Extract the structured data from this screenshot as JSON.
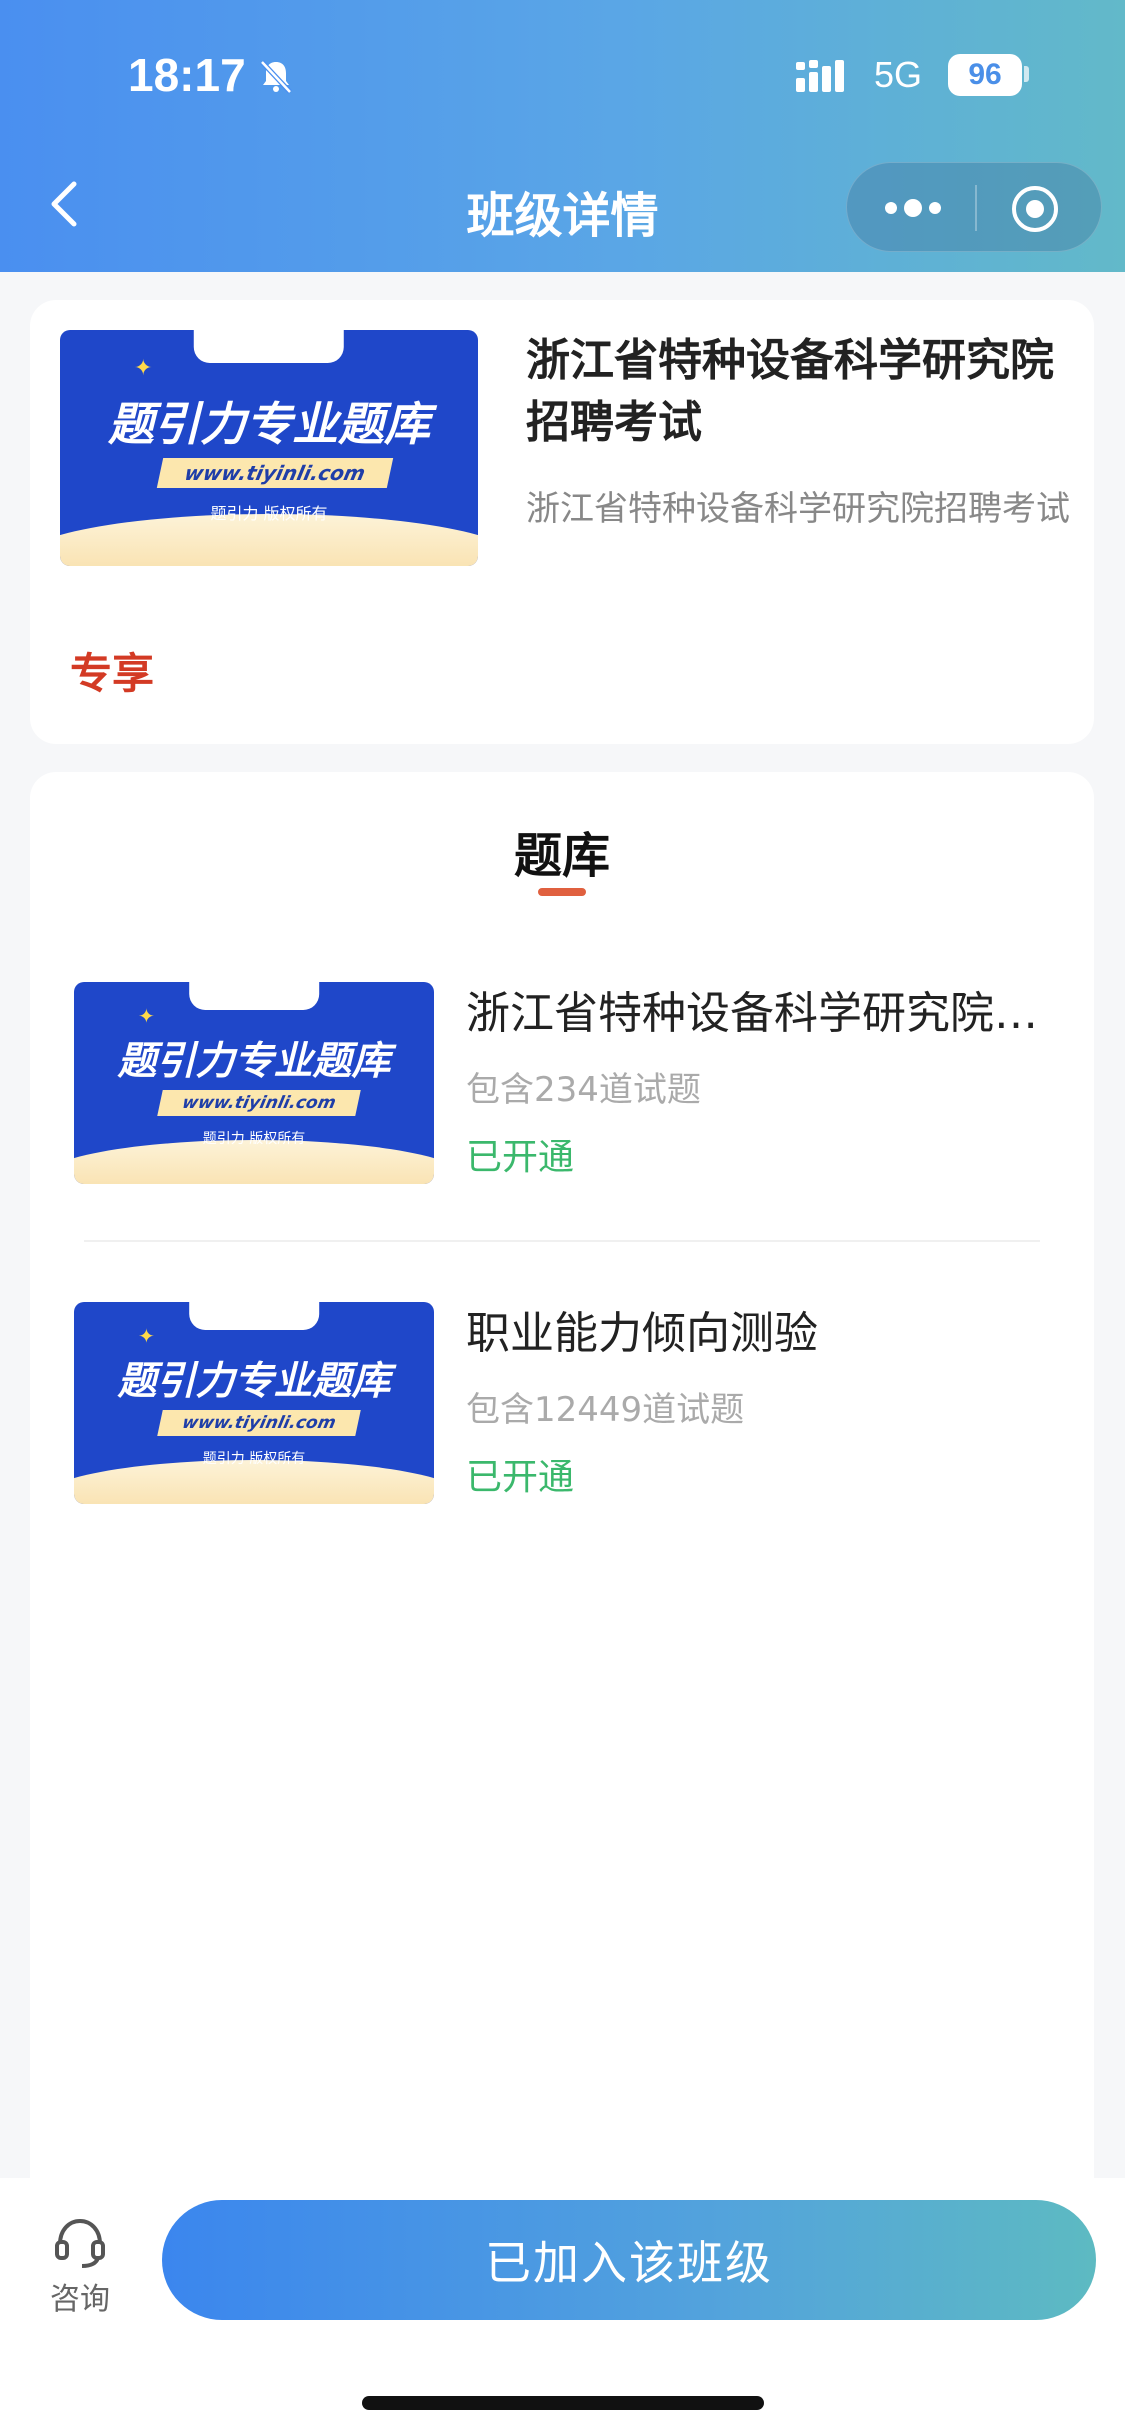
{
  "status_bar": {
    "time": "18:17",
    "network": "5G",
    "battery": "96"
  },
  "nav": {
    "title": "班级详情"
  },
  "class_card": {
    "banner": {
      "headline": "题引力专业题库",
      "url": "www.tiyinli.com",
      "copyright": "题引力 版权所有"
    },
    "title": "浙江省特种设备科学研究院招聘考试",
    "description": "浙江省特种设备科学研究院招聘考试",
    "tag": "专享"
  },
  "question_bank": {
    "section_title": "题库",
    "items": [
      {
        "name": "浙江省特种设备科学研究院招聘考试",
        "count": "包含234道试题",
        "status": "已开通",
        "banner": {
          "headline": "题引力专业题库",
          "url": "www.tiyinli.com",
          "copyright": "题引力 版权所有"
        }
      },
      {
        "name": "职业能力倾向测验",
        "count": "包含12449道试题",
        "status": "已开通",
        "banner": {
          "headline": "题引力专业题库",
          "url": "www.tiyinli.com",
          "copyright": "题引力 版权所有"
        }
      }
    ]
  },
  "bottom": {
    "consult_label": "咨询",
    "join_button": "已加入该班级"
  },
  "colors": {
    "accent_blue": "#4a8ff0",
    "exclusive_red": "#d33a24",
    "opened_green": "#3bb86c"
  }
}
